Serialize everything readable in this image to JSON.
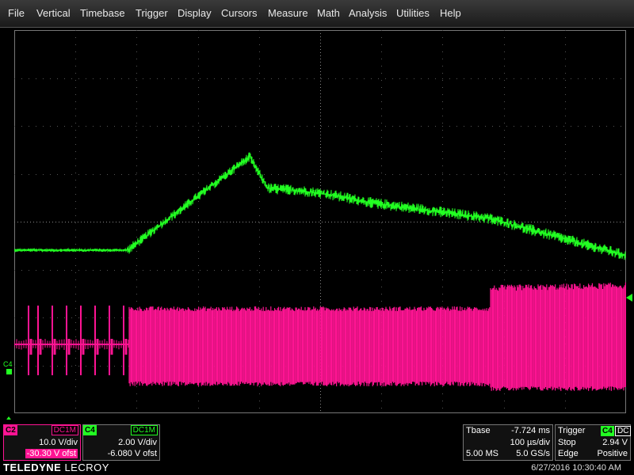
{
  "menu": [
    "File",
    "Vertical",
    "Timebase",
    "Trigger",
    "Display",
    "Cursors",
    "Measure",
    "Math",
    "Analysis",
    "Utilities",
    "Help"
  ],
  "colors": {
    "c2": "#ff1493",
    "c4": "#22ff22",
    "grid": "#666666"
  },
  "markers": {
    "c4_label": "C4",
    "c2_left": "C2",
    "trigger_level_icon": "triangle-marker"
  },
  "c2": {
    "label": "C2",
    "coupling": "DC1M",
    "vdiv": "10.0 V/div",
    "offset": "-30.30 V ofst"
  },
  "c4": {
    "label": "C4",
    "coupling": "DC1M",
    "vdiv": "2.00 V/div",
    "offset": "-6.080 V ofst"
  },
  "timebase": {
    "label": "Tbase",
    "delay": "-7.724 ms",
    "tdiv": "100 µs/div",
    "samples": "5.00 MS",
    "rate": "5.0 GS/s"
  },
  "trigger": {
    "label": "Trigger",
    "source": "C4",
    "coupling": "DC",
    "mode": "Stop",
    "level": "2.94 V",
    "type": "Edge",
    "slope": "Positive"
  },
  "brand": {
    "bold": "TELEDYNE",
    "light": " LECROY"
  },
  "datetime": "6/27/2016 10:30:40 AM"
}
